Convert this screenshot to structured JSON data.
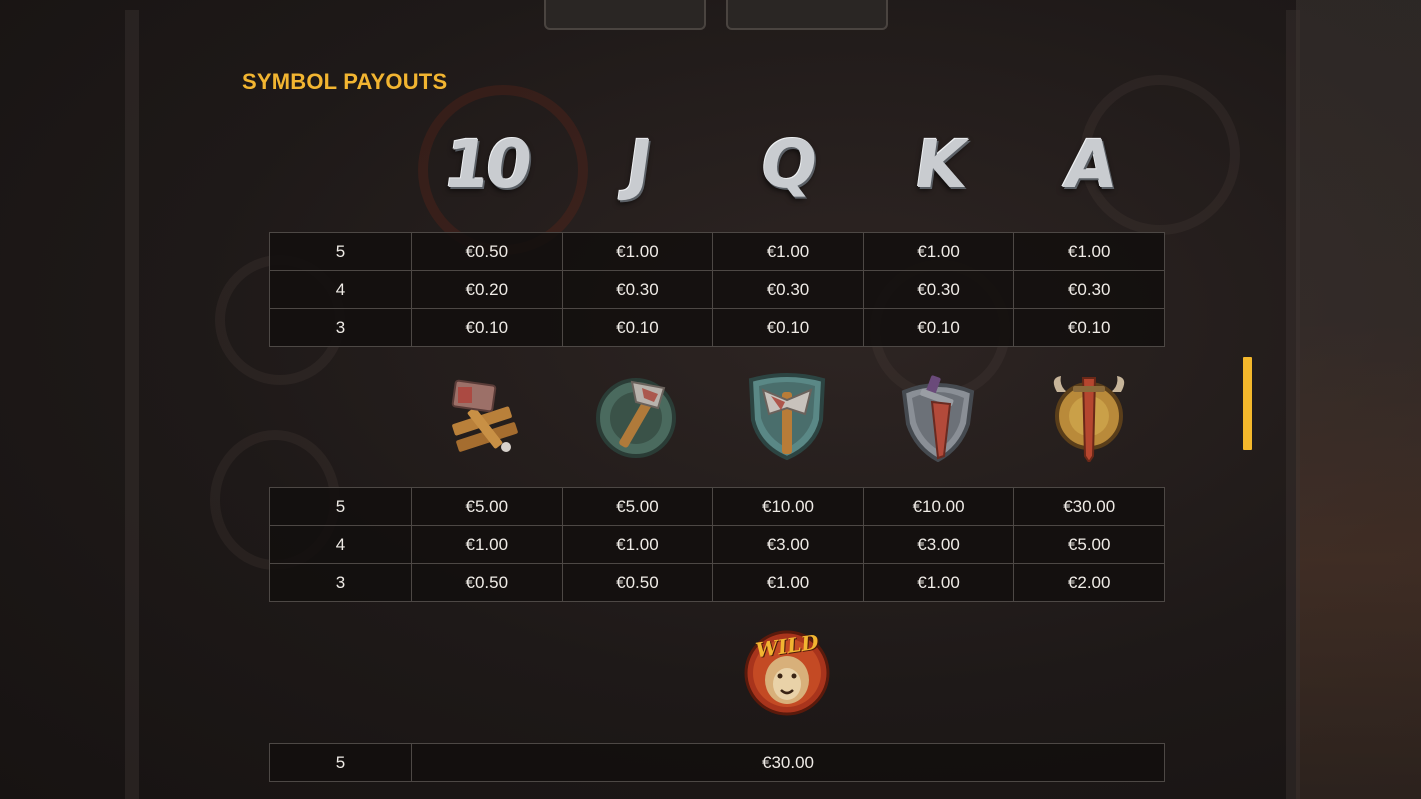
{
  "title": "SYMBOL PAYOUTS",
  "low_symbols": [
    {
      "glyph": "10",
      "icon": "ten-card-icon"
    },
    {
      "glyph": "J",
      "icon": "jack-card-icon"
    },
    {
      "glyph": "Q",
      "icon": "queen-card-icon"
    },
    {
      "glyph": "K",
      "icon": "king-card-icon"
    },
    {
      "glyph": "A",
      "icon": "ace-card-icon"
    }
  ],
  "low_table": [
    {
      "count": "5",
      "values": [
        "€0.50",
        "€1.00",
        "€1.00",
        "€1.00",
        "€1.00"
      ]
    },
    {
      "count": "4",
      "values": [
        "€0.20",
        "€0.30",
        "€0.30",
        "€0.30",
        "€0.30"
      ]
    },
    {
      "count": "3",
      "values": [
        "€0.10",
        "€0.10",
        "€0.10",
        "€0.10",
        "€0.10"
      ]
    }
  ],
  "high_symbols": [
    {
      "icon": "hammer-planks-icon"
    },
    {
      "icon": "axe-round-shield-icon"
    },
    {
      "icon": "axe-shield-icon"
    },
    {
      "icon": "dagger-shield-icon"
    },
    {
      "icon": "horned-shield-sword-icon"
    }
  ],
  "high_table": [
    {
      "count": "5",
      "values": [
        "€5.00",
        "€5.00",
        "€10.00",
        "€10.00",
        "€30.00"
      ]
    },
    {
      "count": "4",
      "values": [
        "€1.00",
        "€1.00",
        "€3.00",
        "€3.00",
        "€5.00"
      ]
    },
    {
      "count": "3",
      "values": [
        "€0.50",
        "€0.50",
        "€1.00",
        "€1.00",
        "€2.00"
      ]
    }
  ],
  "wild_symbol": {
    "label": "WILD",
    "icon": "wild-lion-icon"
  },
  "wild_table": [
    {
      "count": "5",
      "value": "€30.00"
    }
  ],
  "colors": {
    "accent": "#f2b531",
    "scrollbar": "#f4b82c",
    "grid": "#4d4845"
  }
}
